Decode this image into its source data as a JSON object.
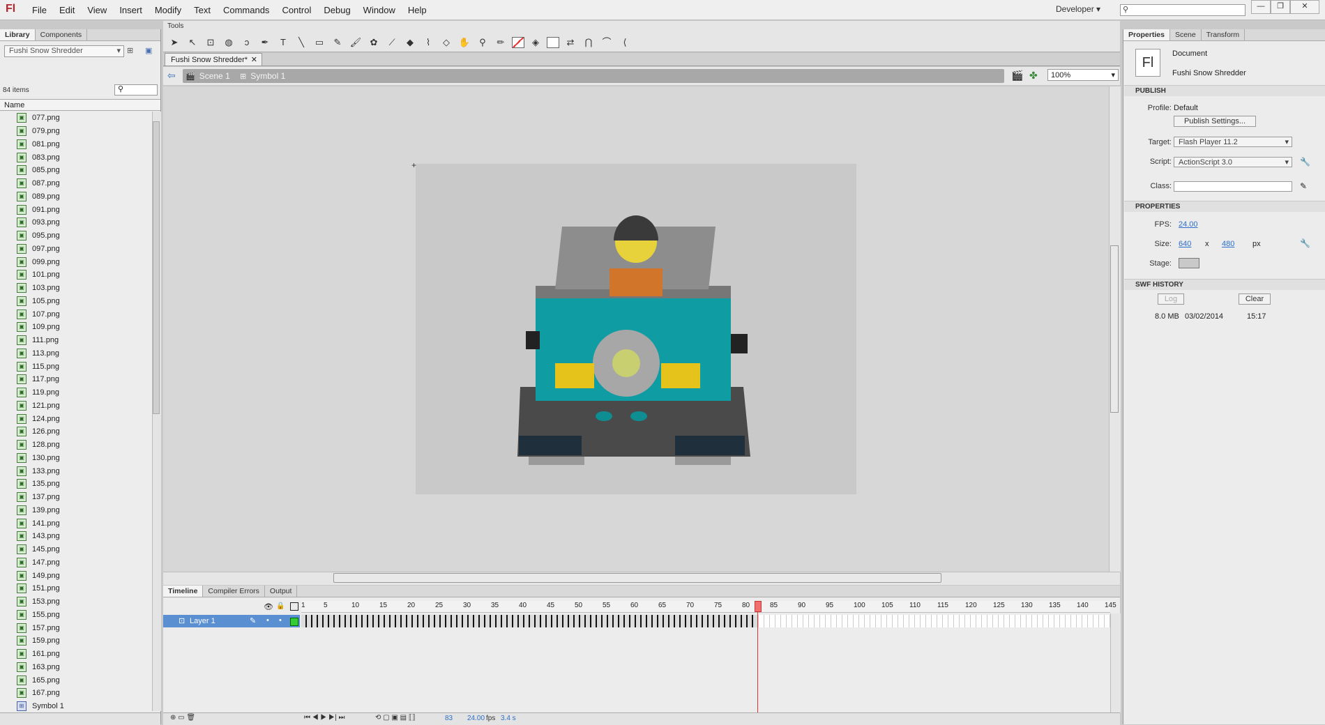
{
  "app": {
    "logo": "Fl"
  },
  "menu": [
    "File",
    "Edit",
    "View",
    "Insert",
    "Modify",
    "Text",
    "Commands",
    "Control",
    "Debug",
    "Window",
    "Help"
  ],
  "workspace": "Developer",
  "library": {
    "tabs": [
      "Library",
      "Components"
    ],
    "document": "Fushi Snow Shredder",
    "count": "84 items",
    "column_name": "Name",
    "items": [
      "077.png",
      "079.png",
      "081.png",
      "083.png",
      "085.png",
      "087.png",
      "089.png",
      "091.png",
      "093.png",
      "095.png",
      "097.png",
      "099.png",
      "101.png",
      "103.png",
      "105.png",
      "107.png",
      "109.png",
      "111.png",
      "113.png",
      "115.png",
      "117.png",
      "119.png",
      "121.png",
      "124.png",
      "126.png",
      "128.png",
      "130.png",
      "133.png",
      "135.png",
      "137.png",
      "139.png",
      "141.png",
      "143.png",
      "145.png",
      "147.png",
      "149.png",
      "151.png",
      "153.png",
      "155.png",
      "157.png",
      "159.png",
      "161.png",
      "163.png",
      "165.png",
      "167.png"
    ],
    "last_item": "Symbol 1"
  },
  "tools": {
    "title": "Tools"
  },
  "document_tab": "Fushi Snow Shredder*",
  "editbar": {
    "scene": "Scene 1",
    "symbol": "Symbol 1",
    "zoom": "100%"
  },
  "timeline": {
    "tabs": [
      "Timeline",
      "Compiler Errors",
      "Output"
    ],
    "layer": "Layer 1",
    "ruler": [
      "1",
      "5",
      "10",
      "15",
      "20",
      "25",
      "30",
      "35",
      "40",
      "45",
      "50",
      "55",
      "60",
      "65",
      "70",
      "75",
      "80",
      "85",
      "90",
      "95",
      "100",
      "105",
      "110",
      "115",
      "120",
      "125",
      "130",
      "135",
      "140",
      "145"
    ],
    "current_frame": "83",
    "fps": "24.00",
    "fps_unit": "fps",
    "time": "3.4 s"
  },
  "properties": {
    "tabs": [
      "Properties",
      "Scene",
      "Transform"
    ],
    "doc_type": "Document",
    "doc_name": "Fushi Snow Shredder",
    "publish_header": "PUBLISH",
    "profile_label": "Profile:",
    "profile": "Default",
    "publish_settings": "Publish Settings...",
    "target_label": "Target:",
    "target": "Flash Player 11.2",
    "script_label": "Script:",
    "script": "ActionScript 3.0",
    "class_label": "Class:",
    "properties_header": "PROPERTIES",
    "fps_label": "FPS:",
    "fps": "24.00",
    "size_label": "Size:",
    "width": "640",
    "x": "x",
    "height": "480",
    "unit": "px",
    "stage_label": "Stage:",
    "swf_header": "SWF HISTORY",
    "log": "Log",
    "clear": "Clear",
    "history_size": "8.0 MB",
    "history_date": "03/02/2014",
    "history_time": "15:17"
  }
}
